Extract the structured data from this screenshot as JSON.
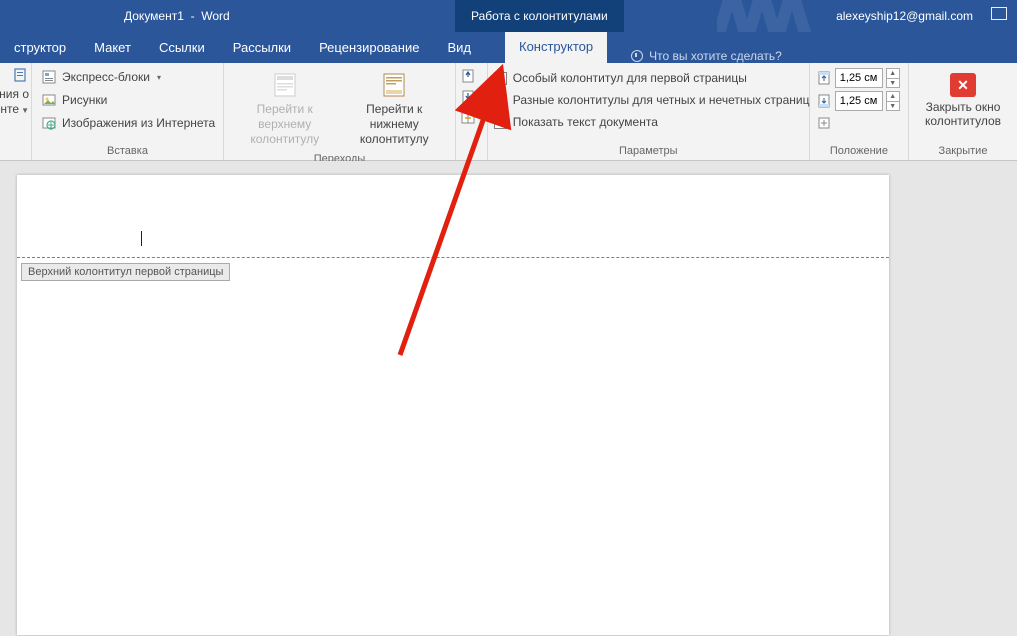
{
  "title": {
    "document": "Документ1",
    "app": "Word"
  },
  "context_tab": "Работа с колонтитулами",
  "user_email": "alexeyship12@gmail.com",
  "tabs": {
    "constructor_partial": "структор",
    "layout": "Макет",
    "links": "Ссылки",
    "mailings": "Рассылки",
    "review": "Рецензирование",
    "view": "Вид",
    "design": "Конструктор"
  },
  "tellme": "Что вы хотите сделать?",
  "ribbon": {
    "partial_left": {
      "line1": "ения о",
      "line2": "менте"
    },
    "insert": {
      "quickparts": "Экспресс-блоки",
      "pictures": "Рисунки",
      "online_pics": "Изображения из Интернета",
      "group": "Вставка"
    },
    "nav": {
      "goto_header": "Перейти к верхнему колонтитулу",
      "goto_footer": "Перейти к нижнему колонтитулу",
      "group": "Переходы"
    },
    "options": {
      "first_page": "Особый колонтитул для первой страницы",
      "odd_even": "Разные колонтитулы для четных и нечетных страниц",
      "show_doc": "Показать текст документа",
      "group": "Параметры"
    },
    "position": {
      "top": "1,25 см",
      "bottom": "1,25 см",
      "group": "Положение"
    },
    "close": {
      "label": "Закрыть окно колонтитулов",
      "group": "Закрытие"
    }
  },
  "page": {
    "header_tag": "Верхний колонтитул первой страницы"
  }
}
